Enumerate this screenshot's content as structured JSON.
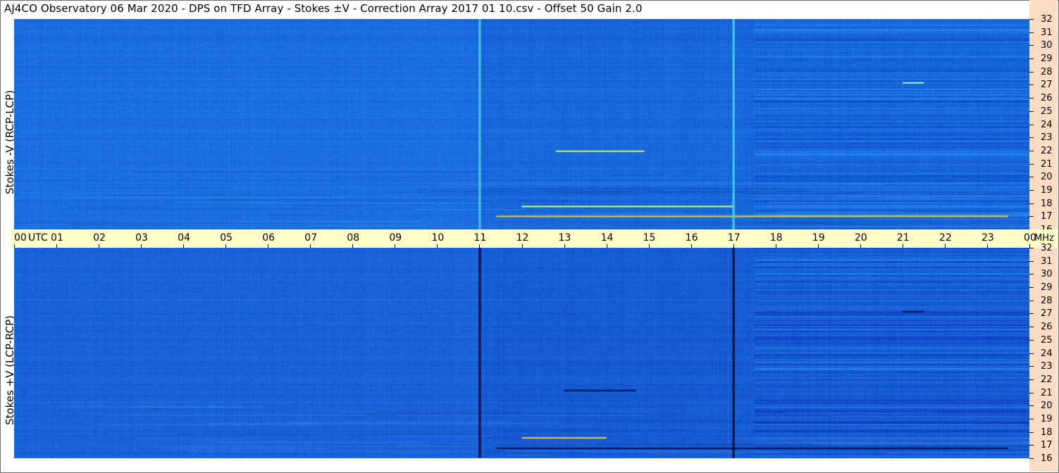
{
  "title": "AJ4CO Observatory  06 Mar 2020  -  DPS on TFD Array  -  Stokes ±V  -  Correction Array 2017 01 10.csv  -  Offset 50  Gain 2.0",
  "chart_data": {
    "type": "heatmap",
    "x_axis": {
      "unit_label": "UTC",
      "ticks": [
        "00",
        "01",
        "02",
        "03",
        "04",
        "05",
        "06",
        "07",
        "08",
        "09",
        "10",
        "11",
        "12",
        "13",
        "14",
        "15",
        "16",
        "17",
        "18",
        "19",
        "20",
        "21",
        "22",
        "23",
        "00"
      ],
      "range": [
        0,
        24
      ]
    },
    "y_axis": {
      "unit_label": "MHz",
      "ticks": [
        "16",
        "17",
        "18",
        "19",
        "20",
        "21",
        "22",
        "23",
        "24",
        "25",
        "26",
        "27",
        "28",
        "29",
        "30",
        "31",
        "32"
      ],
      "range": [
        16,
        32
      ]
    },
    "panels": [
      {
        "label": "Stokes -V (RCP-LCP)",
        "base_color": "#1b6ee0",
        "noisy_after_hour": 17.5,
        "vertical_lines": [
          {
            "hour": 11.0,
            "color": "#40c8e8"
          },
          {
            "hour": 17.0,
            "color": "#40d0e0"
          }
        ],
        "bursts": [
          {
            "hour_start": 11.4,
            "hour_end": 23.5,
            "mhz": 17.05,
            "color": "#e8d020"
          },
          {
            "hour_start": 12.0,
            "hour_end": 17.0,
            "mhz": 17.8,
            "color": "#d8ff60"
          },
          {
            "hour_start": 12.8,
            "hour_end": 14.9,
            "mhz": 22.0,
            "color": "#c8ff40"
          },
          {
            "hour_start": 21.0,
            "hour_end": 21.5,
            "mhz": 27.2,
            "color": "#a0ffd0"
          }
        ]
      },
      {
        "label": "Stokes +V (LCP-RCP)",
        "base_color": "#1a62d8",
        "noisy_after_hour": 17.5,
        "vertical_lines": [
          {
            "hour": 11.0,
            "color": "#0a1040"
          },
          {
            "hour": 17.0,
            "color": "#0a1040"
          }
        ],
        "bursts": [
          {
            "hour_start": 11.4,
            "hour_end": 23.5,
            "mhz": 16.8,
            "color": "#0a1050"
          },
          {
            "hour_start": 12.0,
            "hour_end": 14.0,
            "mhz": 17.6,
            "color": "#f0d040"
          },
          {
            "hour_start": 13.0,
            "hour_end": 14.7,
            "mhz": 21.2,
            "color": "#0a1050"
          },
          {
            "hour_start": 21.0,
            "hour_end": 21.5,
            "mhz": 27.2,
            "color": "#0a1050"
          }
        ]
      }
    ]
  }
}
